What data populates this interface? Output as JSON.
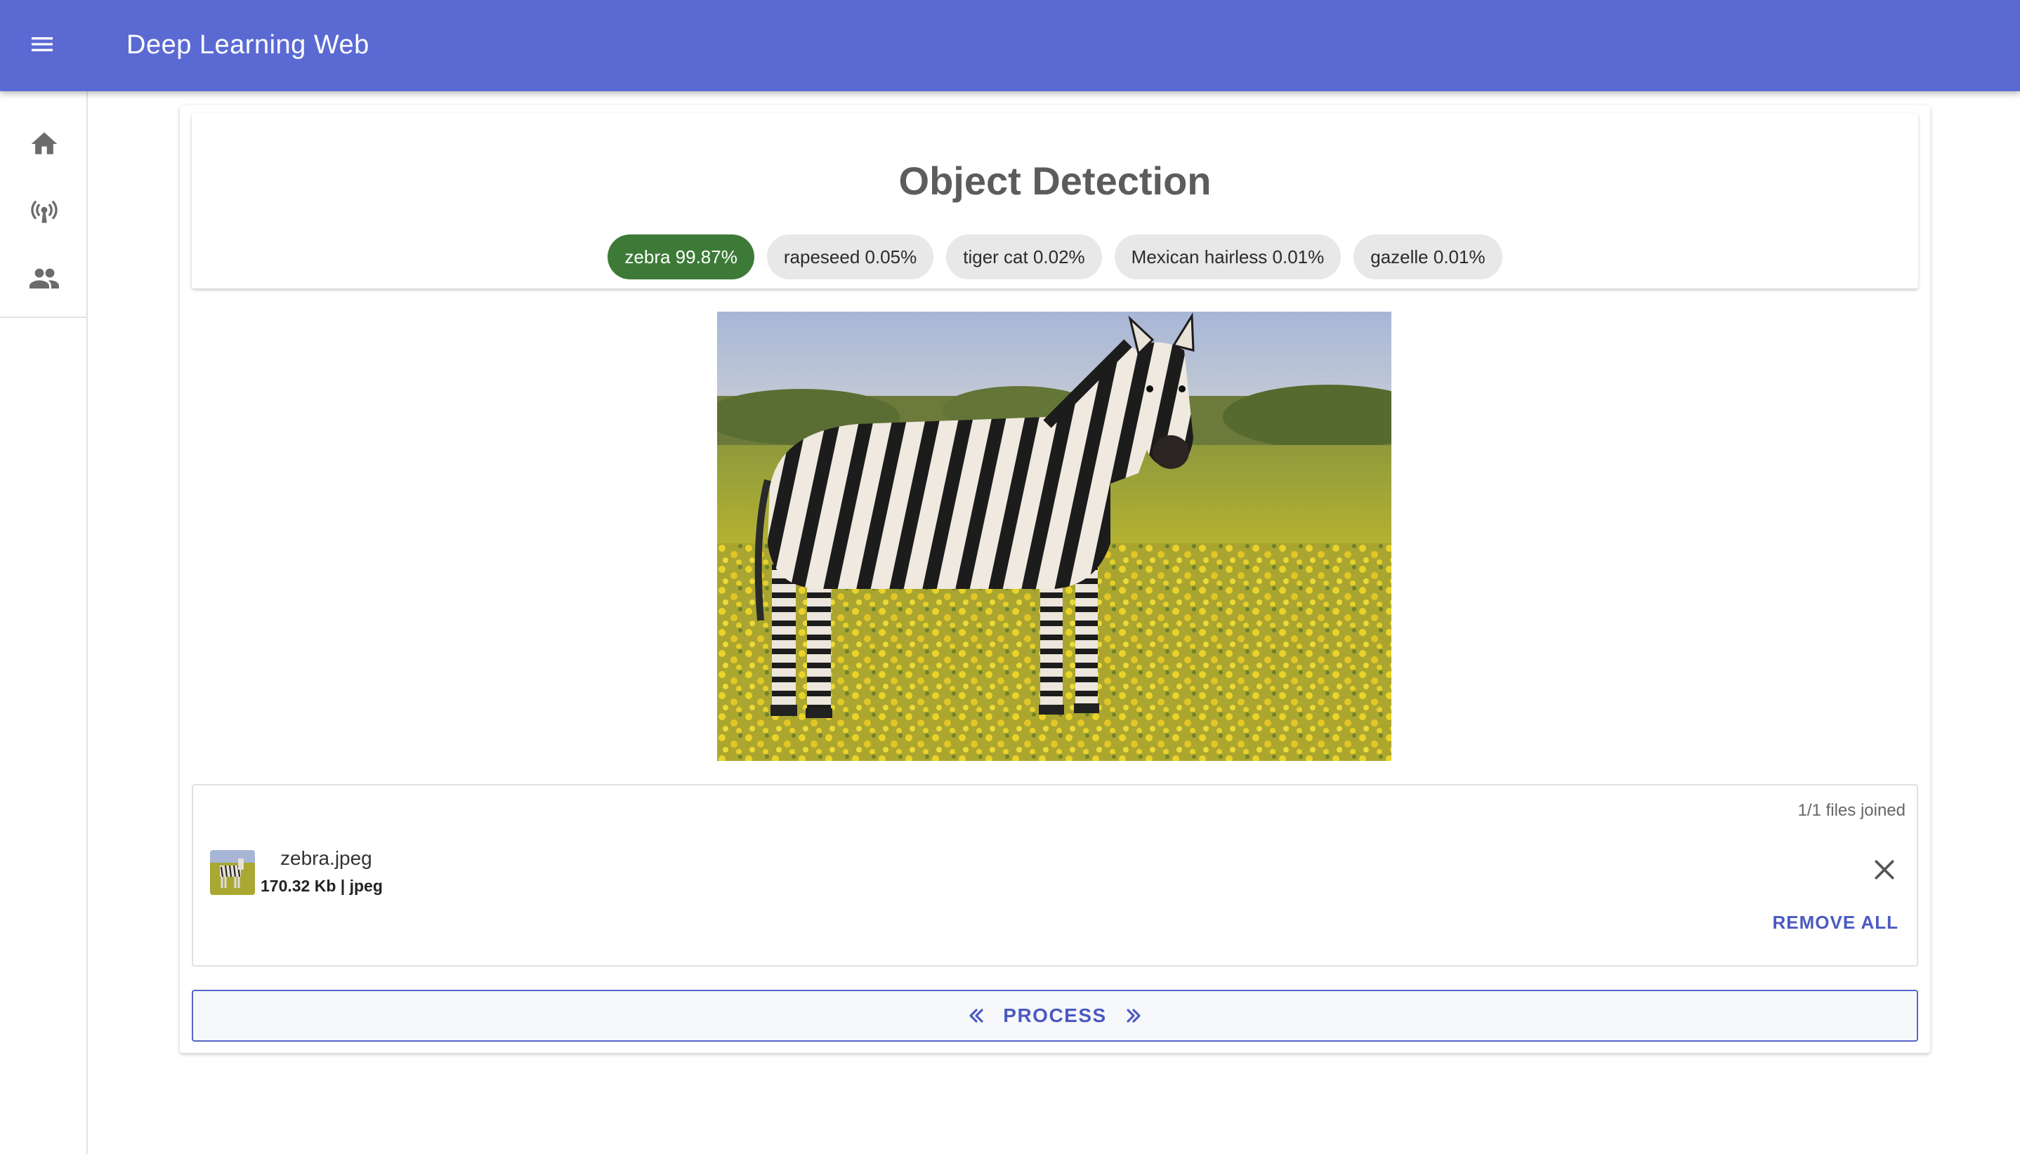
{
  "appbar": {
    "title": "Deep Learning Web",
    "menu_icon": "menu-icon"
  },
  "rail": {
    "items": [
      {
        "icon": "home-icon"
      },
      {
        "icon": "broadcast-icon"
      },
      {
        "icon": "people-icon"
      }
    ]
  },
  "header": {
    "title": "Object Detection"
  },
  "predictions": [
    {
      "label": "zebra 99.87%"
    },
    {
      "label": "rapeseed 0.05%"
    },
    {
      "label": "tiger cat 0.02%"
    },
    {
      "label": "Mexican hairless 0.01%"
    },
    {
      "label": "gazelle 0.01%"
    }
  ],
  "dropzone": {
    "files_joined": "1/1 files joined",
    "file": {
      "name": "zebra.jpeg",
      "meta": "170.32 Kb | jpeg"
    },
    "remove_all_label": "REMOVE ALL"
  },
  "process": {
    "label": "PROCESS"
  },
  "colors": {
    "appbar": "#5b6ad3",
    "top_chip": "#3d7a37",
    "accent": "#4a5ac0"
  }
}
